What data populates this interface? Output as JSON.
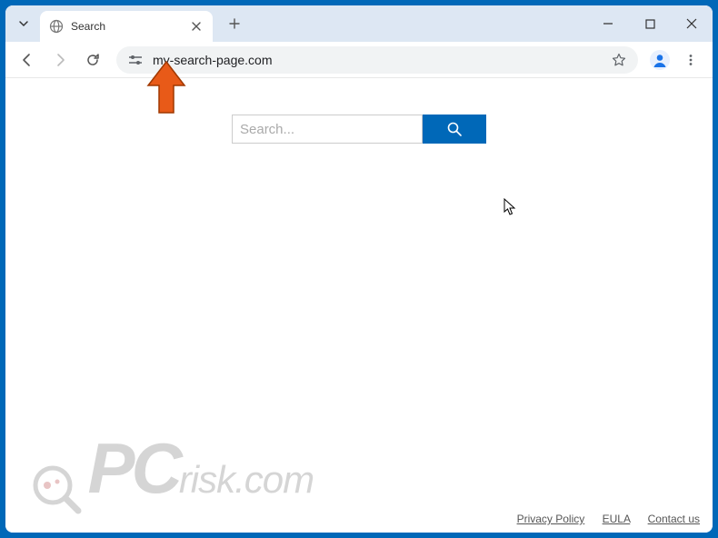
{
  "tab": {
    "title": "Search"
  },
  "address_bar": {
    "url": "my-search-page.com"
  },
  "search": {
    "placeholder": "Search..."
  },
  "footer": {
    "privacy": "Privacy Policy",
    "eula": "EULA",
    "contact": "Contact us"
  },
  "watermark": {
    "pc": "PC",
    "risk": "risk.com"
  }
}
